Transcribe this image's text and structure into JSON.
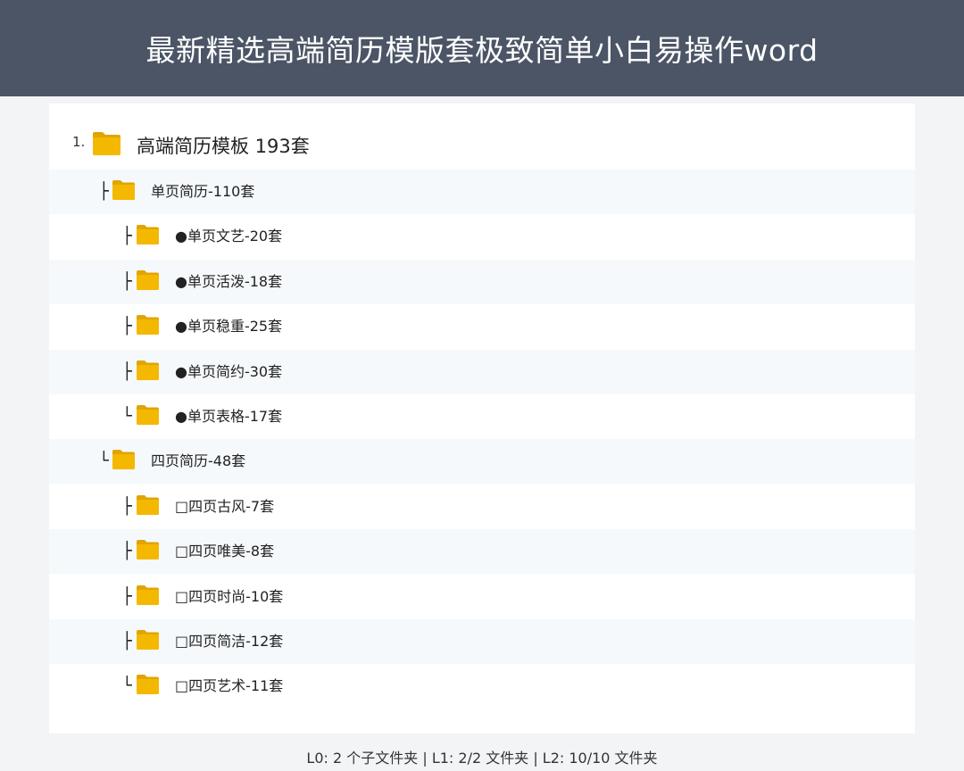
{
  "header": {
    "title": "最新精选高端简历模版套极致简单小白易操作word"
  },
  "tree": {
    "root": {
      "number": "1.",
      "label": "高端简历模板 193套",
      "icon": "folder-icon"
    },
    "rows": [
      {
        "level": 1,
        "connector": "├",
        "label": "单页简历-110套",
        "alt": true
      },
      {
        "level": 2,
        "connector": "├",
        "label": "●单页文艺-20套",
        "alt": false
      },
      {
        "level": 2,
        "connector": "├",
        "label": "●单页活泼-18套",
        "alt": true
      },
      {
        "level": 2,
        "connector": "├",
        "label": "●单页稳重-25套",
        "alt": false
      },
      {
        "level": 2,
        "connector": "├",
        "label": "●单页简约-30套",
        "alt": true
      },
      {
        "level": 2,
        "connector": "└",
        "label": "●单页表格-17套",
        "alt": false
      },
      {
        "level": 1,
        "connector": "└",
        "label": "四页简历-48套",
        "alt": true
      },
      {
        "level": 2,
        "connector": "├",
        "label": "□四页古风-7套",
        "alt": false
      },
      {
        "level": 2,
        "connector": "├",
        "label": "□四页唯美-8套",
        "alt": true
      },
      {
        "level": 2,
        "connector": "├",
        "label": "□四页时尚-10套",
        "alt": false
      },
      {
        "level": 2,
        "connector": "├",
        "label": "□四页简洁-12套",
        "alt": true
      },
      {
        "level": 2,
        "connector": "└",
        "label": "□四页艺术-11套",
        "alt": false
      }
    ]
  },
  "footer": {
    "summary": "L0: 2 个子文件夹 | L1: 2/2 文件夹 | L2: 10/10 文件夹"
  },
  "colors": {
    "header_bg": "#4b5566",
    "folder_yellow": "#f5b800",
    "folder_tab": "#e0a500",
    "row_alt": "#f5f9fc"
  }
}
